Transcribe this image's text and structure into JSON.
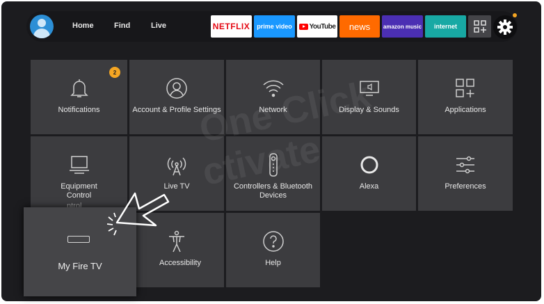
{
  "nav": {
    "home": "Home",
    "find": "Find",
    "live": "Live"
  },
  "apps": [
    {
      "label": "NETFLIX",
      "color": "#e50914",
      "bg": "#ffffff"
    },
    {
      "label": "prime video",
      "color": "#ffffff",
      "bg": "#1a98ff"
    },
    {
      "label": "YouTube",
      "color": "#ffffff",
      "bg": "#ffffff"
    },
    {
      "label": "news",
      "color": "#ffffff",
      "bg": "#ff6a00"
    },
    {
      "label": "amazon music",
      "color": "#ffffff",
      "bg": "#4b2fb3"
    },
    {
      "label": "internet",
      "color": "#ffffff",
      "bg": "#18a9a4"
    }
  ],
  "notification_count": "2",
  "tiles": [
    {
      "label": "Notifications",
      "icon": "bell-icon"
    },
    {
      "label": "Account & Profile Settings",
      "icon": "person-icon"
    },
    {
      "label": "Network",
      "icon": "wifi-icon"
    },
    {
      "label": "Display & Sounds",
      "icon": "display-icon"
    },
    {
      "label": "Applications",
      "icon": "apps-grid-icon"
    },
    {
      "label": "Equipment Control",
      "icon": "monitor-icon"
    },
    {
      "label": "Live TV",
      "icon": "antenna-icon"
    },
    {
      "label": "Controllers & Bluetooth Devices",
      "icon": "remote-icon"
    },
    {
      "label": "Alexa",
      "icon": "alexa-icon"
    },
    {
      "label": "Preferences",
      "icon": "sliders-icon"
    },
    {
      "label": "My Fire TV",
      "icon": "firetv-stick-icon"
    },
    {
      "label": "Accessibility",
      "icon": "accessibility-icon"
    },
    {
      "label": "Help",
      "icon": "help-icon"
    }
  ],
  "partial_label": "ntrol",
  "watermark": {
    "line1": "One Click",
    "line2": "ctivate"
  },
  "colors": {
    "accent": "#f5a623",
    "tile": "#3c3c3f",
    "background": "#1c1c1f"
  }
}
